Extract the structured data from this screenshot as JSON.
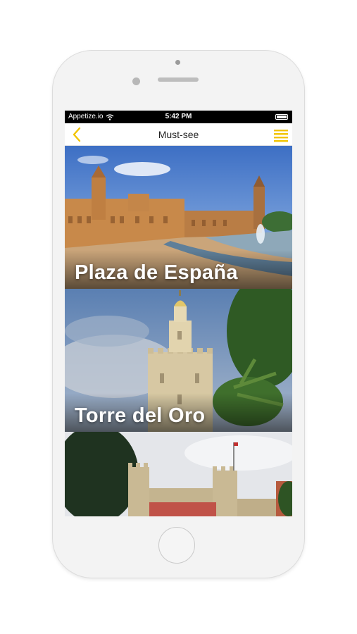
{
  "status_bar": {
    "carrier": "Appetize.io",
    "time": "5:42 PM"
  },
  "nav": {
    "title": "Must-see",
    "accent_color": "#f2c400"
  },
  "cards": [
    {
      "title": "Plaza de España"
    },
    {
      "title": "Torre del Oro"
    },
    {
      "title": ""
    }
  ],
  "icons": {
    "back": "chevron-left-icon",
    "menu": "hamburger-menu-icon",
    "wifi": "wifi-icon",
    "battery": "battery-icon"
  }
}
